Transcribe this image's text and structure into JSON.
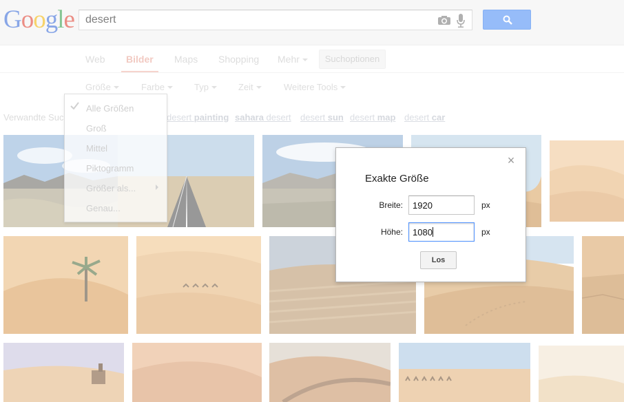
{
  "header": {
    "logo_text": "Google",
    "logo_letters": [
      "G",
      "o",
      "o",
      "g",
      "l",
      "e"
    ],
    "search_value": "desert",
    "camera_icon": "camera-icon",
    "mic_icon": "microphone-icon",
    "search_button_icon": "search-icon",
    "accent_color": "#4b8cf5"
  },
  "nav": {
    "tabs": [
      {
        "label": "Web"
      },
      {
        "label": "Bilder"
      },
      {
        "label": "Maps"
      },
      {
        "label": "Shopping"
      },
      {
        "label": "Mehr"
      }
    ],
    "active_tab": "Bilder",
    "options_label": "Suchoptionen"
  },
  "filters": [
    {
      "label": "Größe"
    },
    {
      "label": "Farbe"
    },
    {
      "label": "Typ"
    },
    {
      "label": "Zeit"
    },
    {
      "label": "Weitere Tools"
    }
  ],
  "related": {
    "prefix": "Verwandte Suc",
    "links": [
      {
        "pre": "desert ",
        "bold": "painting",
        "post": ""
      },
      {
        "pre": "",
        "bold": "sahara",
        "post": " desert"
      },
      {
        "pre": "desert ",
        "bold": "sun",
        "post": ""
      },
      {
        "pre": "desert ",
        "bold": "map",
        "post": ""
      },
      {
        "pre": "desert ",
        "bold": "car",
        "post": ""
      }
    ]
  },
  "size_menu": {
    "items": [
      {
        "label": "Alle Größen"
      },
      {
        "label": "Groß"
      },
      {
        "label": "Mittel"
      },
      {
        "label": "Piktogramm"
      },
      {
        "label": "Größer als..."
      },
      {
        "label": "Genau..."
      }
    ],
    "checked": "Alle Größen"
  },
  "dialog": {
    "title": "Exakte Größe",
    "width_label": "Breite:",
    "width_value": "1920",
    "height_label": "Höhe:",
    "height_value": "1080",
    "unit": "px",
    "button_label": "Los",
    "close_glyph": "×"
  }
}
